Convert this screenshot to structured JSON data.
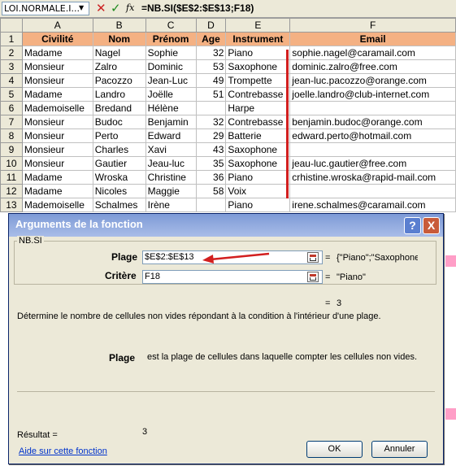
{
  "formula_bar": {
    "name_box": "LOI.NORMALE.I...",
    "formula": "=NB.SI($E$2:$E$13;F18)",
    "icons": [
      "cancel-icon",
      "enter-icon",
      "fx-icon"
    ]
  },
  "sheet": {
    "columns": [
      "A",
      "B",
      "C",
      "D",
      "E",
      "F"
    ],
    "header_row": [
      "Civilité",
      "Nom",
      "Prénom",
      "Age",
      "Instrument",
      "Email"
    ],
    "rows": [
      {
        "num": "1"
      },
      {
        "num": "2",
        "cells": [
          "Madame",
          "Nagel",
          "Sophie",
          "32",
          "Piano",
          "sophie.nagel@caramail.com"
        ]
      },
      {
        "num": "3",
        "cells": [
          "Monsieur",
          "Zalro",
          "Dominic",
          "53",
          "Saxophone",
          "dominic.zalro@free.com"
        ]
      },
      {
        "num": "4",
        "cells": [
          "Monsieur",
          "Pacozzo",
          "Jean-Luc",
          "49",
          "Trompette",
          "jean-luc.pacozzo@orange.com"
        ]
      },
      {
        "num": "5",
        "cells": [
          "Madame",
          "Landro",
          "Joëlle",
          "51",
          "Contrebasse",
          "joelle.landro@club-internet.com"
        ]
      },
      {
        "num": "6",
        "cells": [
          "Mademoiselle",
          "Bredand",
          "Hélène",
          "",
          "Harpe",
          ""
        ]
      },
      {
        "num": "7",
        "cells": [
          "Monsieur",
          "Budoc",
          "Benjamin",
          "32",
          "Contrebasse",
          "benjamin.budoc@orange.com"
        ]
      },
      {
        "num": "8",
        "cells": [
          "Monsieur",
          "Perto",
          "Edward",
          "29",
          "Batterie",
          "edward.perto@hotmail.com"
        ]
      },
      {
        "num": "9",
        "cells": [
          "Monsieur",
          "Charles",
          "Xavi",
          "43",
          "Saxophone",
          ""
        ]
      },
      {
        "num": "10",
        "cells": [
          "Monsieur",
          "Gautier",
          "Jeau-luc",
          "35",
          "Saxophone",
          "jeau-luc.gautier@free.com"
        ]
      },
      {
        "num": "11",
        "cells": [
          "Madame",
          "Wroska",
          "Christine",
          "36",
          "Piano",
          "crhistine.wroska@rapid-mail.com"
        ]
      },
      {
        "num": "12",
        "cells": [
          "Madame",
          "Nicoles",
          "Maggie",
          "58",
          "Voix",
          ""
        ]
      },
      {
        "num": "13",
        "cells": [
          "Mademoiselle",
          "Schalmes",
          "Irène",
          "",
          "Piano",
          "irene.schalmes@caramail.com"
        ]
      }
    ]
  },
  "dialog": {
    "title": "Arguments de la fonction",
    "help_button": "?",
    "close_button": "X",
    "function_name": "NB.SI",
    "args": [
      {
        "label": "Plage",
        "value": "$E$2:$E$13",
        "result": "{\"Piano\";\"Saxophone\"",
        "icon": "collapse-range-icon"
      },
      {
        "label": "Critère",
        "value": "F18",
        "result": "\"Piano\"",
        "icon": "collapse-range-icon"
      }
    ],
    "equals": "=",
    "formula_result": "3",
    "description": "Détermine le nombre de cellules non vides répondant à la condition à l'intérieur d'une plage.",
    "arg_help_label": "Plage",
    "arg_help_text": "est la plage de cellules dans laquelle compter les cellules non vides.",
    "result_label": "Résultat =",
    "result_value": "3",
    "help_link": "Aide sur cette fonction",
    "ok_button": "OK",
    "cancel_button": "Annuler"
  },
  "colors": {
    "header_fill": "#f4b183",
    "annotation_red": "#d21f1f",
    "dialog_bg": "#ece9d8",
    "title_gradient": "#7d9ad6"
  }
}
